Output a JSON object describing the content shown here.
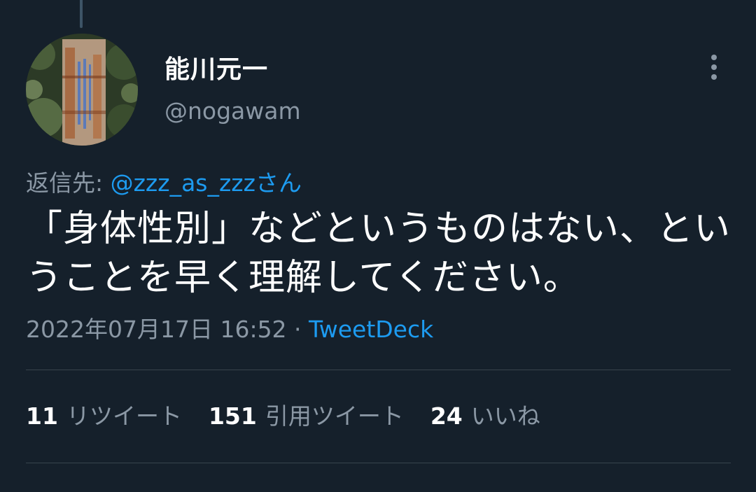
{
  "tweet": {
    "display_name": "能川元一",
    "handle": "@nogawam",
    "reply_prefix": "返信先: ",
    "reply_to": "@zzz_as_zzzさん",
    "text": "「身体性別」などというものはない、ということを早く理解してください。",
    "timestamp": "2022年07月17日 16:52",
    "separator": " · ",
    "source": "TweetDeck",
    "stats": [
      {
        "count": "11",
        "label": "リツイート"
      },
      {
        "count": "151",
        "label": "引用ツイート"
      },
      {
        "count": "24",
        "label": "いいね"
      }
    ]
  },
  "icons": {
    "more": "more-vertical-icon"
  },
  "colors": {
    "background": "#15202b",
    "text": "#ffffff",
    "muted": "#8b98a5",
    "accent": "#1d9bf0",
    "divider": "#38444d"
  }
}
